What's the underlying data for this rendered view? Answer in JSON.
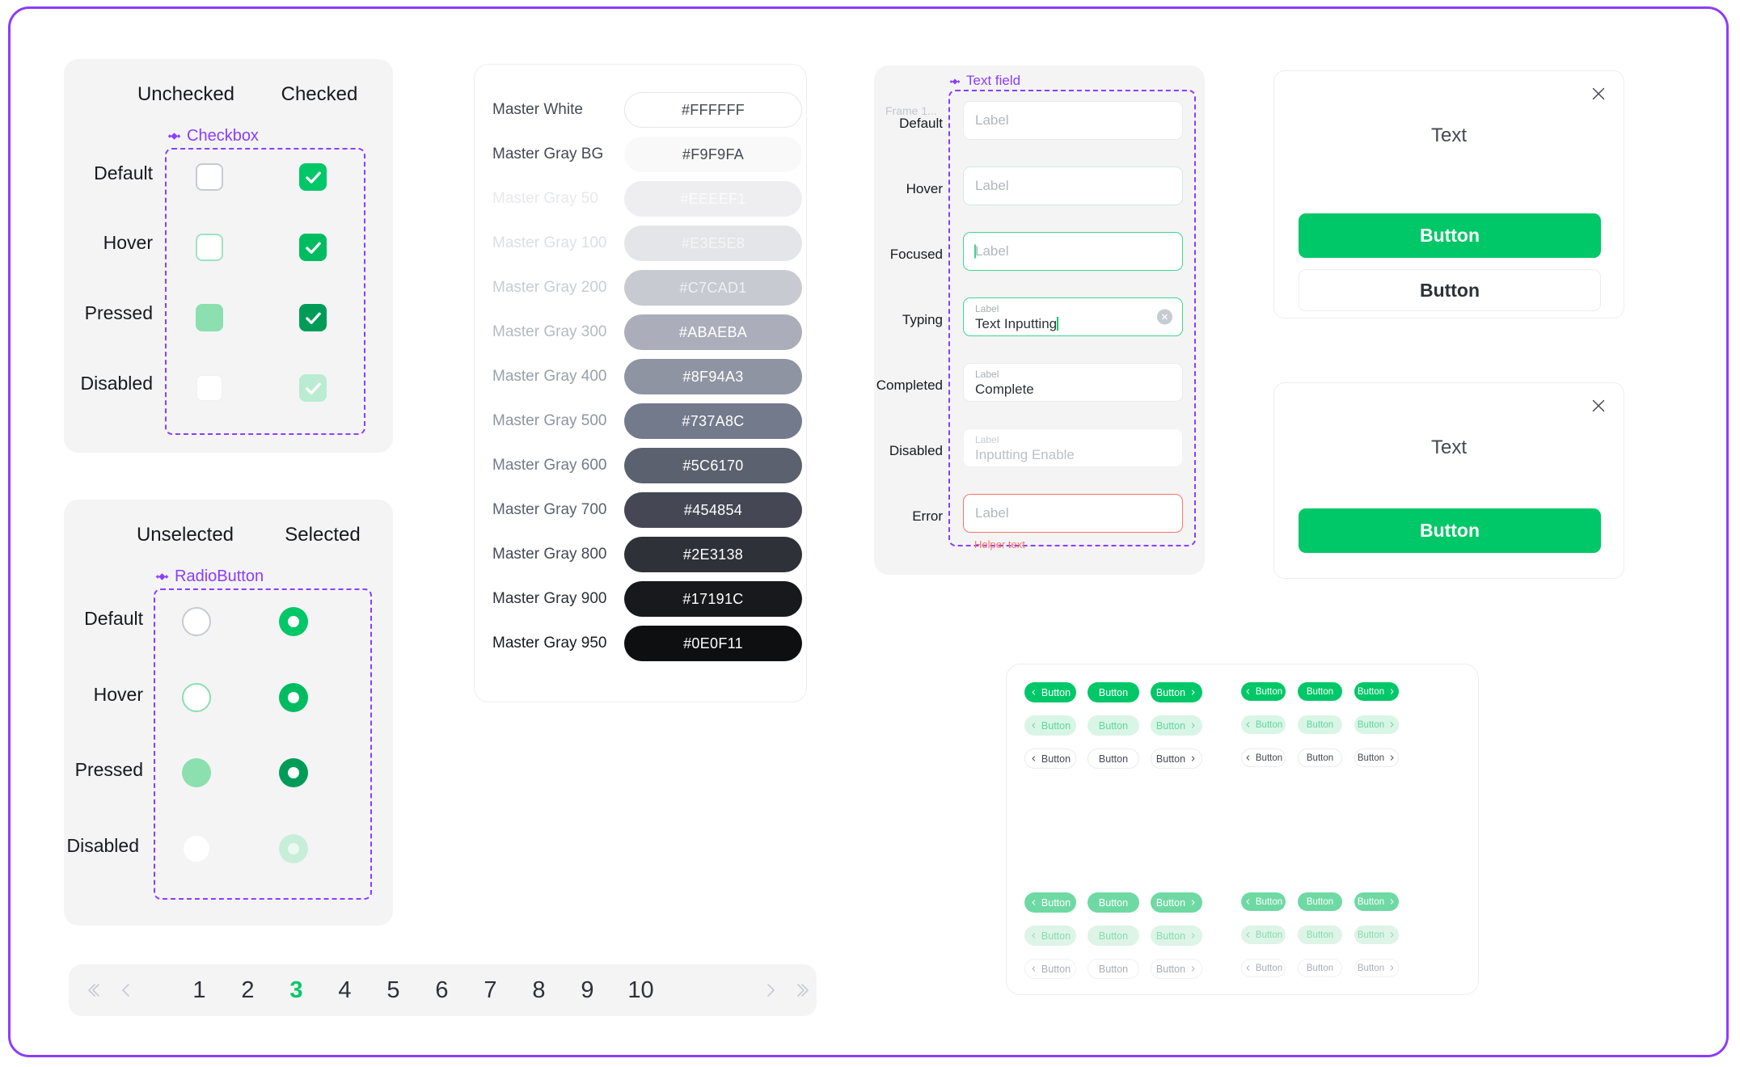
{
  "theme": {
    "accent_green": "#00C767",
    "frame_purple": "#8B3DFF",
    "error_red": "#F8766A",
    "panel_gray": "#F4F4F5"
  },
  "checkbox_panel": {
    "columns": [
      "Unchecked",
      "Checked"
    ],
    "component_name": "Checkbox",
    "states": [
      "Default",
      "Hover",
      "Pressed",
      "Disabled"
    ]
  },
  "radio_panel": {
    "columns": [
      "Unselected",
      "Selected"
    ],
    "component_name": "RadioButton",
    "states": [
      "Default",
      "Hover",
      "Pressed",
      "Disabled"
    ]
  },
  "palette": {
    "swatches": [
      {
        "name": "Master White",
        "hex": "#FFFFFF",
        "bg": "#FFFFFF",
        "text_color": "#454854",
        "name_color": "#454854",
        "border": "#E3E5E8"
      },
      {
        "name": "Master Gray BG",
        "hex": "#F9F9FA",
        "bg": "#F9F9FA",
        "text_color": "#454854",
        "name_color": "#454854",
        "border": "none"
      },
      {
        "name": "Master Gray 50",
        "hex": "#EEEEF1",
        "bg": "#EEEEF1",
        "text_color": "#FAFAFB",
        "name_color": "#E8E9EC",
        "border": "none"
      },
      {
        "name": "Master Gray 100",
        "hex": "#E3E5E8",
        "bg": "#E3E5E8",
        "text_color": "#F4F5F6",
        "name_color": "#DDDFE3",
        "border": "none"
      },
      {
        "name": "Master Gray 200",
        "hex": "#C7CAD1",
        "bg": "#C7CAD1",
        "text_color": "#EFF0F2",
        "name_color": "#C9CCD2",
        "border": "none"
      },
      {
        "name": "Master Gray 300",
        "hex": "#ABAEBA",
        "bg": "#ABAEBA",
        "text_color": "#FFFFFF",
        "name_color": "#B6B9C2",
        "border": "none"
      },
      {
        "name": "Master Gray 400",
        "hex": "#8F94A3",
        "bg": "#8F94A3",
        "text_color": "#FFFFFF",
        "name_color": "#9AA0AC",
        "border": "none"
      },
      {
        "name": "Master Gray 500",
        "hex": "#737A8C",
        "bg": "#737A8C",
        "text_color": "#FFFFFF",
        "name_color": "#8F94A3",
        "border": "none"
      },
      {
        "name": "Master Gray 600",
        "hex": "#5C6170",
        "bg": "#5C6170",
        "text_color": "#FFFFFF",
        "name_color": "#737A8C",
        "border": "none"
      },
      {
        "name": "Master Gray 700",
        "hex": "#454854",
        "bg": "#454854",
        "text_color": "#FFFFFF",
        "name_color": "#5C6170",
        "border": "none"
      },
      {
        "name": "Master Gray 800",
        "hex": "#2E3138",
        "bg": "#2E3138",
        "text_color": "#FFFFFF",
        "name_color": "#454854",
        "border": "none"
      },
      {
        "name": "Master Gray 900",
        "hex": "#17191C",
        "bg": "#17191C",
        "text_color": "#FFFFFF",
        "name_color": "#2E3138",
        "border": "none"
      },
      {
        "name": "Master Gray 950",
        "hex": "#0E0F11",
        "bg": "#0E0F11",
        "text_color": "#FFFFFF",
        "name_color": "#17191C",
        "border": "none"
      }
    ]
  },
  "textfield_panel": {
    "frame_label": "Frame 1...",
    "component_name": "Text field",
    "rows": [
      {
        "state": "Default",
        "placeholder": "Label"
      },
      {
        "state": "Hover",
        "placeholder": "Label"
      },
      {
        "state": "Focused",
        "placeholder": "Label"
      },
      {
        "state": "Typing",
        "mini_label": "Label",
        "value": "Text Inputting"
      },
      {
        "state": "Completed",
        "mini_label": "Label",
        "value": "Complete"
      },
      {
        "state": "Disabled",
        "mini_label": "Label",
        "value": "Inputting Enable"
      },
      {
        "state": "Error",
        "placeholder": "Label",
        "helper_text": "Helper text"
      }
    ]
  },
  "modals": [
    {
      "title": "Text",
      "primary_button": "Button",
      "secondary_button": "Button",
      "close_icon": "close-icon"
    },
    {
      "title": "Text",
      "primary_button": "Button",
      "close_icon": "close-icon"
    }
  ],
  "pagination": {
    "first_icon": "chevron-double-left-icon",
    "prev_icon": "chevron-left-icon",
    "next_icon": "chevron-right-icon",
    "last_icon": "chevron-double-right-icon",
    "pages": [
      "1",
      "2",
      "3",
      "4",
      "5",
      "6",
      "7",
      "8",
      "9",
      "10"
    ],
    "active_page": "3"
  },
  "button_grid": {
    "label": "Button",
    "groups": [
      {
        "disabled": false,
        "blocks": [
          {
            "size": "lg",
            "variants": [
              "solid",
              "light",
              "outline"
            ],
            "icons": [
              "left",
              "none",
              "right"
            ]
          },
          {
            "size": "sm",
            "variants": [
              "solid",
              "light",
              "outline"
            ],
            "icons": [
              "left",
              "none",
              "right"
            ]
          }
        ]
      },
      {
        "disabled": true,
        "blocks": [
          {
            "size": "lg",
            "variants": [
              "solid-d",
              "light-d",
              "outline-d"
            ],
            "icons": [
              "left",
              "none",
              "right"
            ]
          },
          {
            "size": "sm",
            "variants": [
              "solid-d",
              "light-d",
              "outline-d"
            ],
            "icons": [
              "left",
              "none",
              "right"
            ]
          }
        ]
      }
    ]
  }
}
